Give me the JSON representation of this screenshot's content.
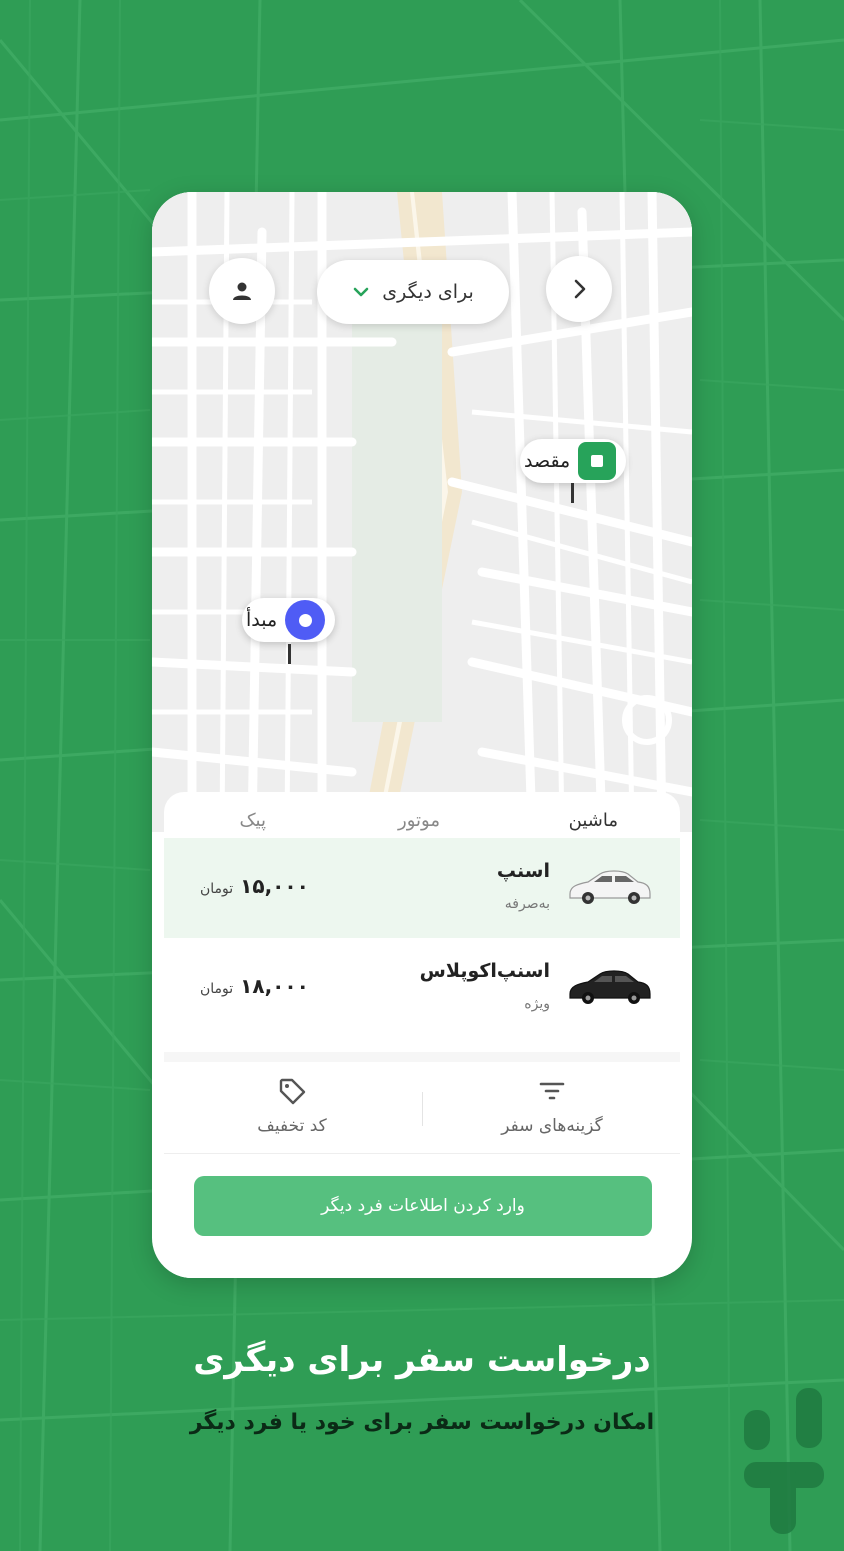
{
  "colors": {
    "background": "#2f9d55",
    "accent": "#27a35a",
    "origin_marker": "#4f5cf5",
    "cta": "#56c07f",
    "selected_row": "#edf7ef"
  },
  "map": {
    "back_icon": "chevron-right-icon",
    "profile_icon": "person-icon",
    "rider_selector": {
      "label": "برای دیگری",
      "icon": "chevron-down-icon"
    },
    "destination_label": "مقصد",
    "origin_label": "مبدأ"
  },
  "sheet": {
    "tabs": [
      {
        "label": "ماشین",
        "active": true
      },
      {
        "label": "موتور",
        "active": false
      },
      {
        "label": "پیک",
        "active": false
      }
    ],
    "rides": [
      {
        "title": "اسنپ",
        "subtitle": "به‌صرفه",
        "price": "۱۵,۰۰۰",
        "unit": "تومان",
        "selected": true,
        "car_color": "white"
      },
      {
        "title": "اسنپ‌اکوپلاس",
        "subtitle": "ویژه",
        "price": "۱۸,۰۰۰",
        "unit": "تومان",
        "selected": false,
        "car_color": "black"
      }
    ],
    "options": {
      "trip_options": {
        "label": "گزینه‌های سفر",
        "icon": "filter-icon"
      },
      "discount": {
        "label": "کد تخفیف",
        "icon": "tag-icon"
      }
    },
    "cta_label": "وارد کردن اطلاعات فرد دیگر"
  },
  "promo": {
    "headline": "درخواست سفر برای دیگری",
    "subline": "امکان درخواست سفر برای خود یا فرد دیگر"
  },
  "brand_logo": {
    "icon": "bazaar-logo-icon"
  }
}
